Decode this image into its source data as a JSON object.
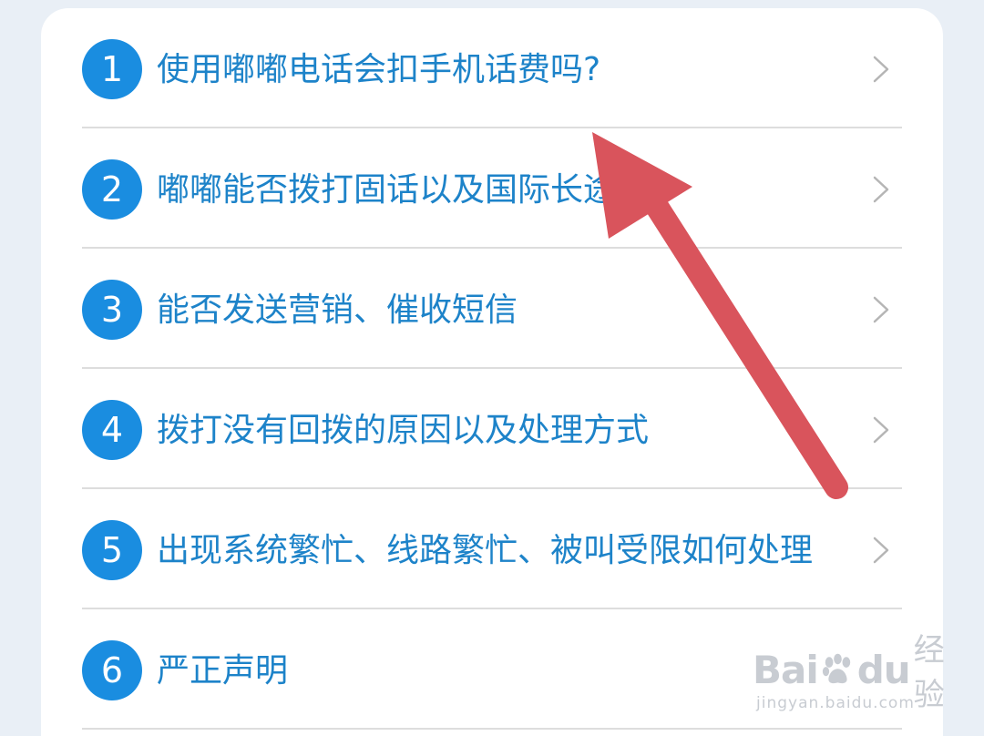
{
  "faq": {
    "items": [
      {
        "number": "1",
        "text": "使用嘟嘟电话会扣手机话费吗?"
      },
      {
        "number": "2",
        "text": "嘟嘟能否拨打固话以及国际长途?"
      },
      {
        "number": "3",
        "text": "能否发送营销、催收短信"
      },
      {
        "number": "4",
        "text": "拨打没有回拨的原因以及处理方式"
      },
      {
        "number": "5",
        "text": "出现系统繁忙、线路繁忙、被叫受限如何处理"
      },
      {
        "number": "6",
        "text": "严正声明"
      }
    ]
  },
  "watermark": {
    "logo_text_1": "Bai",
    "logo_text_2": "du",
    "logo_cn": "经验",
    "url": "jingyan.baidu.com"
  },
  "colors": {
    "badge": "#1a8de0",
    "text": "#1d83c9",
    "annotation_arrow": "#d9545c",
    "background": "#e9eff6"
  },
  "icons": {
    "row_chevron": "chevron-right-icon",
    "annotation": "arrow-pointer-icon",
    "watermark_logo": "paw-icon"
  }
}
